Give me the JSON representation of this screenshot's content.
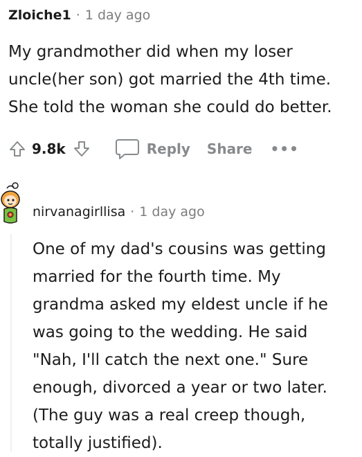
{
  "comment1": {
    "author": "Zloiche1",
    "separator": "·",
    "time": "1 day ago",
    "lines": [
      "My grandmother did when my loser",
      "uncle(her son) got married the 4th time.",
      "She told the woman she could do better."
    ],
    "votes": "9.8k",
    "reply_label": "Reply",
    "share_label": "Share",
    "more_label": "•••"
  },
  "comment2": {
    "author": "nirvanagirllisa",
    "separator": "·",
    "time": "1 day ago",
    "lines": [
      "One of my dad's cousins was getting",
      "married for the fourth time. My",
      "grandma asked my eldest uncle if he",
      "was going to the wedding. He said",
      "\"Nah, I'll catch the next one.\" Sure",
      "enough, divorced a year or two later.",
      "(The guy was a real creep though,",
      "totally justified)."
    ]
  },
  "colors": {
    "text": "#1c1c1c",
    "meta": "#7c7c7c",
    "action": "#878a8c",
    "thread_line": "#edeff1"
  },
  "icons": [
    "upvote-icon",
    "downvote-icon",
    "comment-bubble-icon",
    "snoo-avatar-icon"
  ]
}
